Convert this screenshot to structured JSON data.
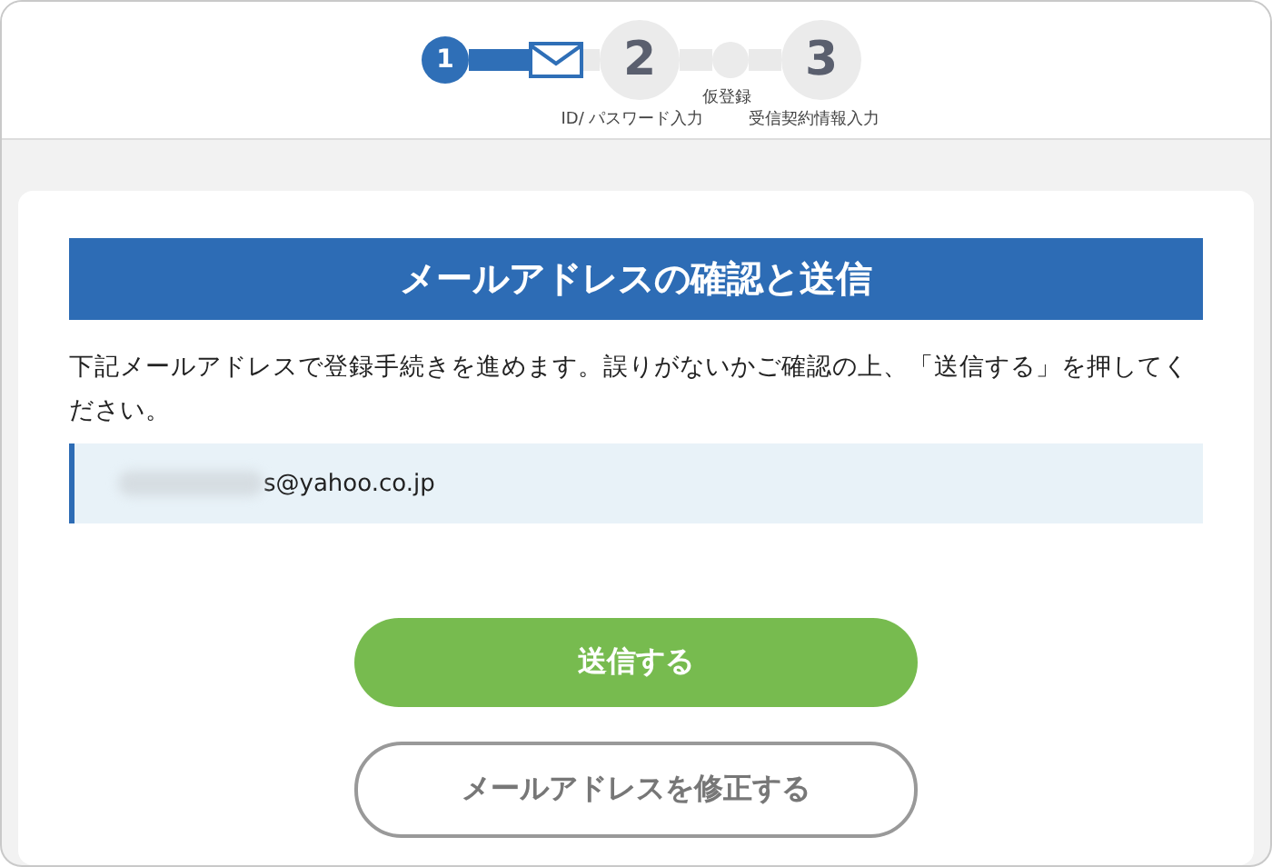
{
  "steps": [
    {
      "kind": "number",
      "number": "1",
      "selected": true
    },
    {
      "kind": "number",
      "number": "2",
      "label": "ID/ パスワード入力",
      "selected": false
    },
    {
      "kind": "dot",
      "label": "仮登録",
      "selected": false
    },
    {
      "kind": "number",
      "number": "3",
      "label": "受信契約情報入力",
      "selected": false
    }
  ],
  "heading": "メールアドレスの確認と送信",
  "message": "下記メールアドレスで登録手続きを進めます。誤りがないかご確認の上、「送信する」を押してください。",
  "email": "s@yahoo.co.jp",
  "buttons": [
    {
      "kind": "primary",
      "label": "送信する"
    },
    {
      "kind": "secondary",
      "label": "メールアドレスを修正する"
    }
  ]
}
